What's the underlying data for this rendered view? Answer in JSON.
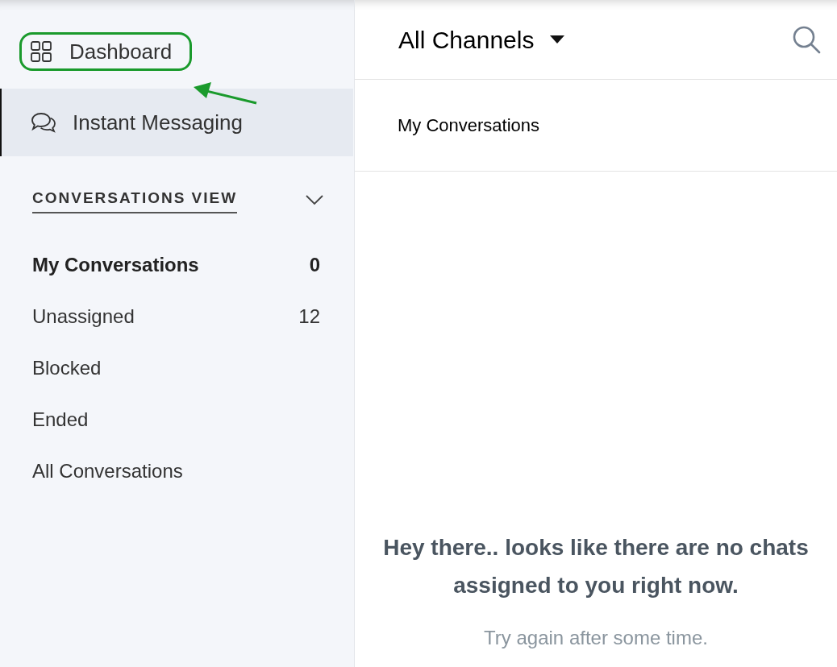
{
  "sidebar": {
    "nav": [
      {
        "label": "Dashboard",
        "kind": "grid",
        "selected": false
      },
      {
        "label": "Instant Messaging",
        "kind": "chat",
        "selected": true
      }
    ],
    "section": {
      "title": "CONVERSATIONS VIEW",
      "expanded": true
    },
    "views": [
      {
        "label": "My Conversations",
        "count": "0",
        "selected": true
      },
      {
        "label": "Unassigned",
        "count": "12",
        "selected": false
      },
      {
        "label": "Blocked",
        "selected": false
      },
      {
        "label": "Ended",
        "selected": false
      },
      {
        "label": "All Conversations",
        "selected": false
      }
    ]
  },
  "main": {
    "channel_picker": "All Channels",
    "subheader": "My Conversations",
    "empty_state": {
      "title": "Hey there.. looks like there are no chats assigned to you right now.",
      "subtitle": "Try again after some time."
    }
  }
}
